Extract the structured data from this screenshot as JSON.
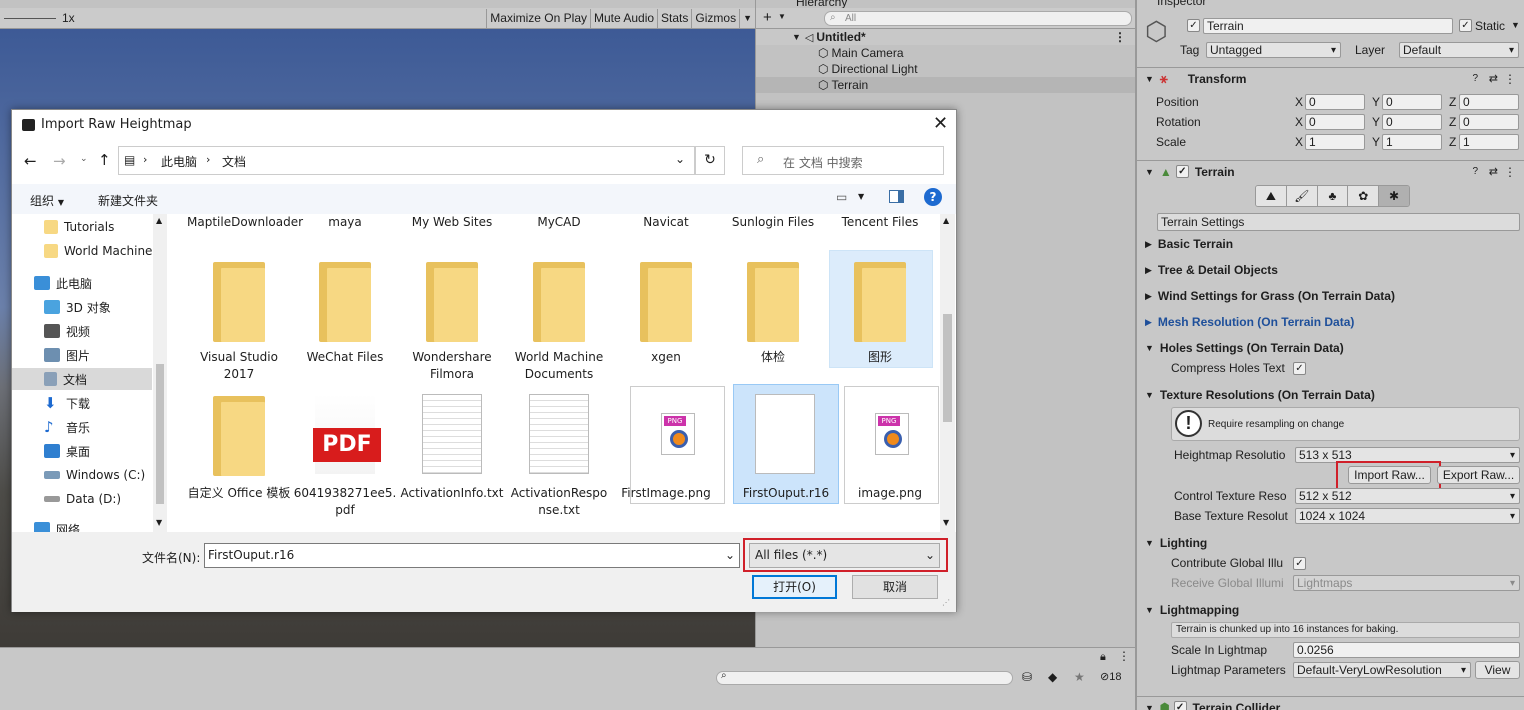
{
  "game": {
    "scale_label": "1x",
    "buttons": [
      "Maximize On Play",
      "Mute Audio",
      "Stats",
      "Gizmos"
    ]
  },
  "hierarchy": {
    "tab": "Hierarchy",
    "search_placeholder": "All",
    "scene": "Untitled*",
    "items": [
      "Main Camera",
      "Directional Light",
      "Terrain"
    ]
  },
  "bottom": {
    "count": "18"
  },
  "inspector": {
    "tab": "Inspector",
    "object_name": "Terrain",
    "static_label": "Static",
    "tag_label": "Tag",
    "tag_value": "Untagged",
    "layer_label": "Layer",
    "layer_value": "Default",
    "transform": {
      "title": "Transform",
      "rows": [
        {
          "label": "Position",
          "x": "0",
          "y": "0",
          "z": "0"
        },
        {
          "label": "Rotation",
          "x": "0",
          "y": "0",
          "z": "0"
        },
        {
          "label": "Scale",
          "x": "1",
          "y": "1",
          "z": "1"
        }
      ]
    },
    "terrain": {
      "title": "Terrain",
      "settings_label": "Terrain Settings",
      "sections": {
        "basic": "Basic Terrain",
        "tree": "Tree & Detail Objects",
        "wind": "Wind Settings for Grass (On Terrain Data)",
        "mesh": "Mesh Resolution (On Terrain Data)",
        "holes": "Holes Settings (On Terrain Data)",
        "texture": "Texture Resolutions (On Terrain Data)",
        "lighting": "Lighting",
        "lightmapping": "Lightmapping"
      },
      "compress_holes": "Compress Holes Text",
      "resample_warning": "Require resampling on change",
      "heightmap_label": "Heightmap Resolutio",
      "heightmap_value": "513 x 513",
      "import_raw": "Import Raw...",
      "export_raw": "Export Raw...",
      "control_label": "Control Texture Reso",
      "control_value": "512 x 512",
      "base_label": "Base Texture Resolut",
      "base_value": "1024 x 1024",
      "contribute_gi": "Contribute Global Illu",
      "receive_gi": "Receive Global Illumi",
      "receive_gi_value": "Lightmaps",
      "chunk_info": "Terrain is chunked up into 16 instances for baking.",
      "scale_lightmap_label": "Scale In Lightmap",
      "scale_lightmap_value": "0.0256",
      "lightmap_params_label": "Lightmap Parameters",
      "lightmap_params_value": "Default-VeryLowResolution",
      "view_button": "View"
    },
    "collider_title": "Terrain Collider"
  },
  "dialog": {
    "title": "Import Raw Heightmap",
    "breadcrumb": [
      "此电脑",
      "文档"
    ],
    "search_placeholder": "在 文档 中搜索",
    "organize": "组织",
    "new_folder": "新建文件夹",
    "nav": [
      "Tutorials",
      "World Machine",
      "此电脑",
      "3D 对象",
      "视频",
      "图片",
      "文档",
      "下载",
      "音乐",
      "桌面",
      "Windows (C:)",
      "Data (D:)",
      "网络"
    ],
    "top_row": [
      "MaptileDownloader",
      "maya",
      "My Web Sites",
      "MyCAD",
      "Navicat",
      "Sunlogin Files",
      "Tencent Files"
    ],
    "folder_row": [
      "Visual Studio 2017",
      "WeChat Files",
      "Wondershare Filmora",
      "World Machine Documents",
      "xgen",
      "体检",
      "图形"
    ],
    "file_row": [
      "自定义 Office 模板",
      "6041938271ee5.pdf",
      "ActivationInfo.txt",
      "ActivationResponse.txt",
      "FirstImage.png",
      "FirstOuput.r16",
      "image.png"
    ],
    "filename_label": "文件名(N):",
    "filename_value": "FirstOuput.r16",
    "filter_value": "All files (*.*)",
    "open_button": "打开(O)",
    "cancel_button": "取消"
  }
}
